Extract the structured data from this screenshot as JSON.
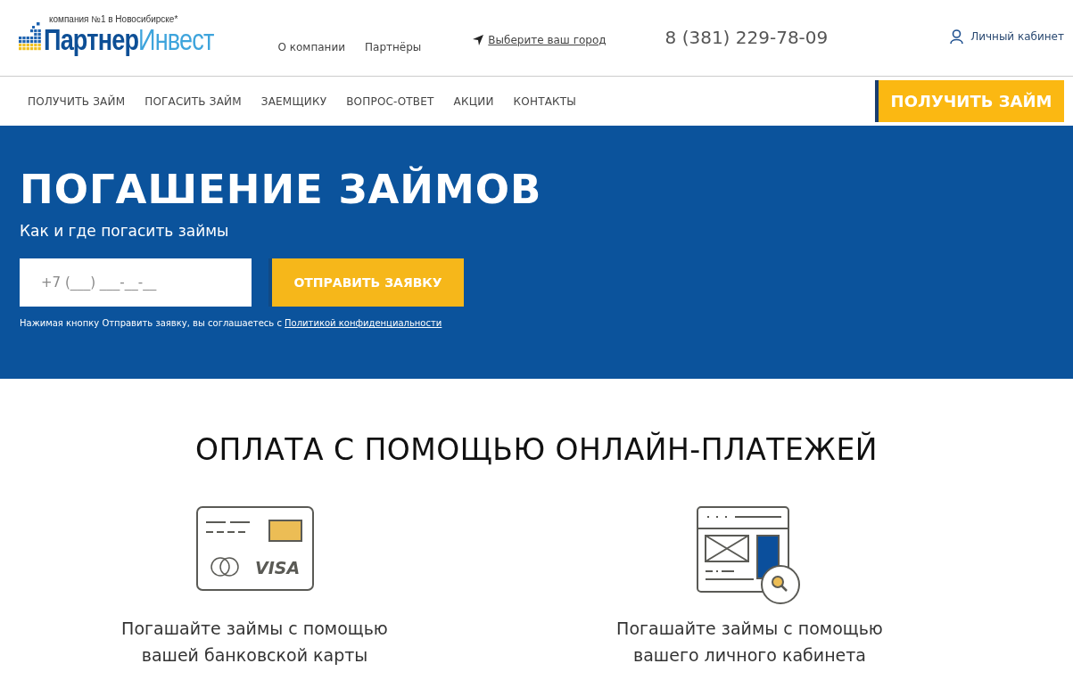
{
  "header": {
    "logo": {
      "tagline": "компания №1 в Новосибирске*",
      "name_first": "Партнер",
      "name_second": "Инвест"
    },
    "top_links": [
      "О компании",
      "Партнёры"
    ],
    "city_link": "Выберите ваш город",
    "phone": "8 (381) 229-78-09",
    "account_link": "Личный кабинет"
  },
  "nav": {
    "items": [
      "ПОЛУЧИТЬ ЗАЙМ",
      "ПОГАСИТЬ ЗАЙМ",
      "ЗАЕМЩИКУ",
      "ВОПРОС-ОТВЕТ",
      "АКЦИИ",
      "КОНТАКТЫ"
    ],
    "cta": "ПОЛУЧИТЬ ЗАЙМ"
  },
  "hero": {
    "title": "ПОГАШЕНИЕ ЗАЙМОВ",
    "subtitle": "Как и где погасить займы",
    "phone_field": {
      "placeholder": "+7 (___) ___-__-__"
    },
    "submit": "ОТПРАВИТЬ ЗАЯВКУ",
    "consent": "Нажимая кнопку Отправить заявку, вы соглашаетесь с ",
    "consent_link": "Политикой конфиденциальности"
  },
  "payments": {
    "title": "ОПЛАТА С ПОМОЩЬЮ ОНЛАЙН-ПЛАТЕЖЕЙ",
    "methods": [
      {
        "kind": "card",
        "icon_text": "VISA",
        "caption": "Погашайте займы с помощью вашей банковской карты"
      },
      {
        "kind": "cabinet",
        "caption": "Погашайте займы с помощью вашего личного кабинета"
      }
    ]
  }
}
